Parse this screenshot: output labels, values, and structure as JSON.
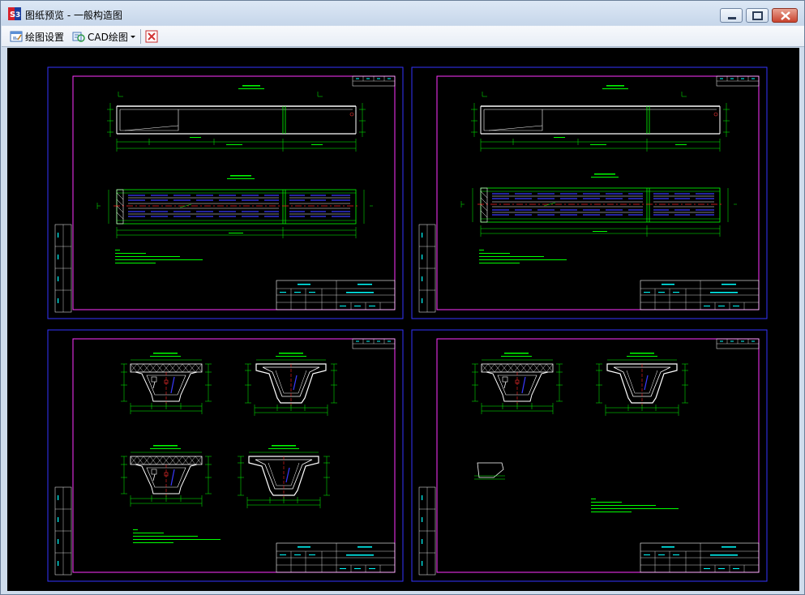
{
  "window": {
    "title": "图纸预览 - 一般构造图",
    "icon": "app-logo-icon"
  },
  "toolbar": {
    "settings_label": "绘图设置",
    "settings_icon": "drawing-settings-icon",
    "cad_label": "CAD绘图",
    "cad_icon": "cad-icon",
    "close_icon": "close-red-icon"
  },
  "colors": {
    "canvas": "#000000",
    "sheet_border": "#3333ff",
    "inner_frame": "#ff33ff",
    "cad_green": "#00ff00",
    "cad_white": "#ffffff",
    "cad_blue": "#0000ff",
    "cad_red": "#ff0000",
    "cad_cyan": "#00ffff"
  }
}
